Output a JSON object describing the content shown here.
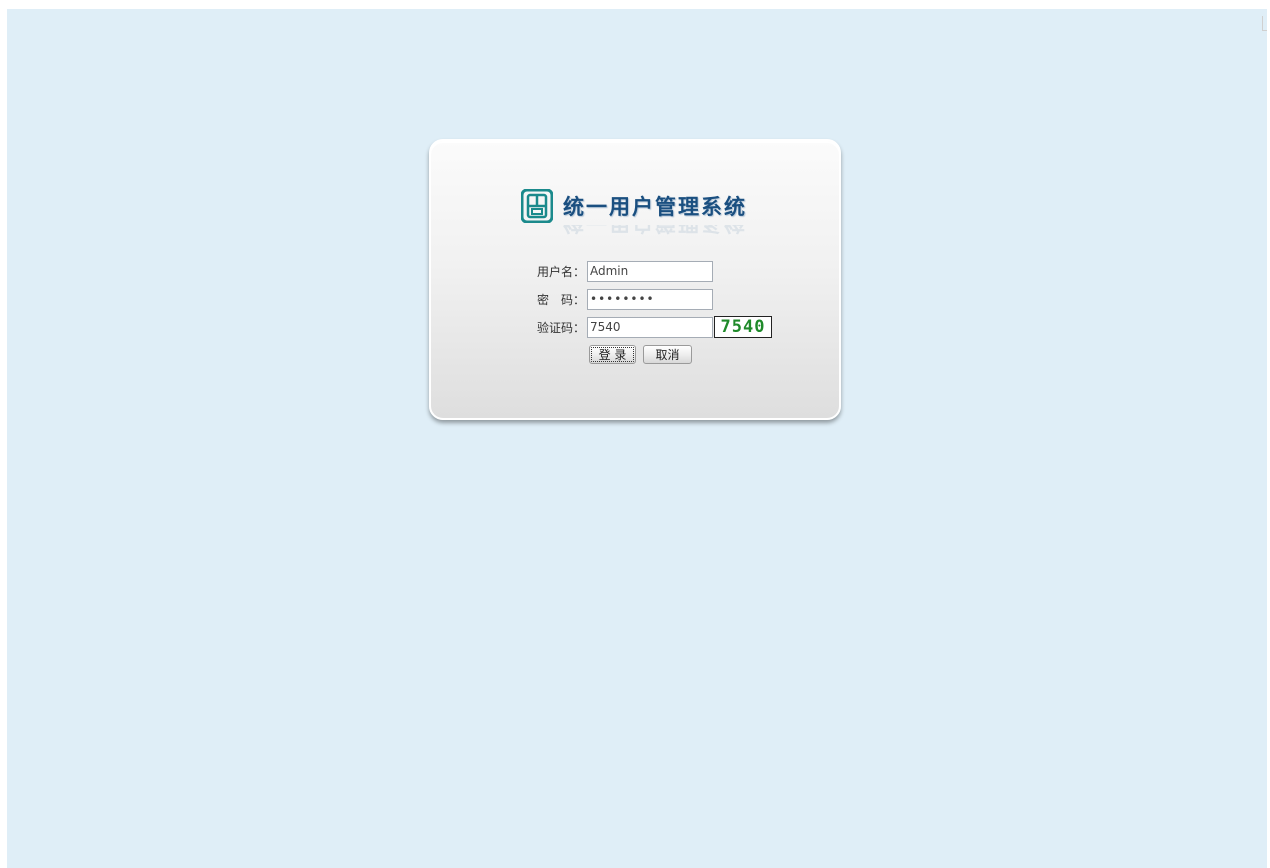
{
  "app": {
    "title": "统一用户管理系统"
  },
  "form": {
    "username_label": "用户名：",
    "username_value": "Admin",
    "password_label": "密　码：",
    "password_value": "••••••••",
    "captcha_label": "验证码：",
    "captcha_value": "7540",
    "captcha_image_text": "7540"
  },
  "buttons": {
    "login": "登 录",
    "cancel": "取消"
  },
  "colors": {
    "background": "#dfeef7",
    "title": "#1a4f80",
    "logo": "#1b8a8c",
    "captcha_text": "#1f8a2a"
  },
  "icons": {
    "logo": "app-logo-icon"
  }
}
